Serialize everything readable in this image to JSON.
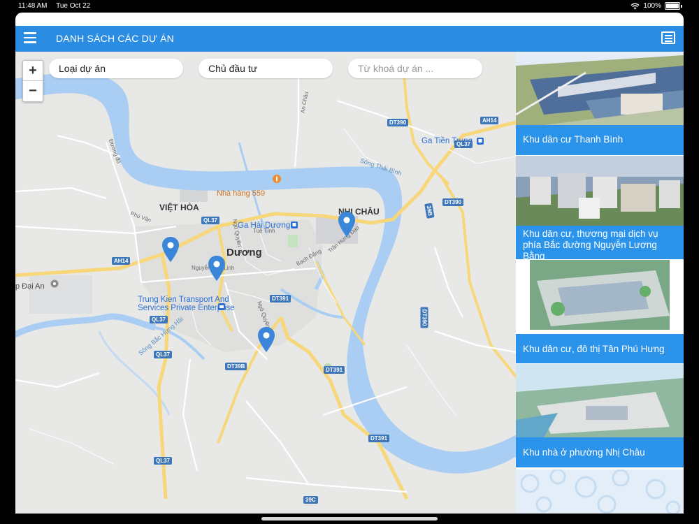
{
  "status_bar": {
    "time": "11:48 AM",
    "date": "Tue Oct 22",
    "battery": "100%",
    "icons": [
      "wifi-icon",
      "battery-icon"
    ]
  },
  "navbar": {
    "title": "DANH SÁCH CÁC DỰ ÁN",
    "menu_icon": "hamburger-menu-icon",
    "list_icon": "list-view-icon",
    "color": "#2a8de3"
  },
  "filters": {
    "project_type": "Loại dự án",
    "investor": "Chủ đầu tư",
    "keyword_placeholder": "Từ khoá dự án ..."
  },
  "zoom": {
    "in": "+",
    "out": "−"
  },
  "map": {
    "labels": {
      "viet_hoa": "VIỆT HÒA",
      "nhi_chau": "NHỊ CHÂU",
      "city": "Hải Dương",
      "city_partial": "Dương",
      "restaurant": "Nhà hàng 559",
      "station": "Ga Hải Dương",
      "station_tien_trung": "Ga Tiền Trung",
      "transport": "Trung Kien Transport\nAnd Services\nPrivate Enterprise",
      "river": "Sông Thái Bình",
      "river2": "Sông Bắc Hưng Hải",
      "dai_an": "p Đại An",
      "street": "Nguyễn Văn Linh",
      "street2": "Trần Hưng Đạo",
      "street3": "Tuệ Tĩnh",
      "street4": "Phú Vân",
      "street5": "Đường đỏ",
      "street6": "An Châu",
      "street7": "Ngô Quyền",
      "street8": "Bạch Đằng",
      "street9": "Ngô Quyền"
    },
    "road_shields": [
      "DT390",
      "AH14",
      "QL37",
      "DT390",
      "DT391",
      "DT39B",
      "DT391",
      "DT391",
      "QL37",
      "QL37",
      "AH14",
      "QL37",
      "QL37",
      "DT390",
      "39B",
      "39C"
    ],
    "pin_color": "#3b86d9",
    "pins": 4
  },
  "projects": [
    {
      "name": "Khu dân cư Thanh Bình"
    },
    {
      "name": "Khu dân cư, thương mại dịch vụ phía Bắc đường Nguyễn Lương Bằng"
    },
    {
      "name": "Khu dân cư, đô thị Tân Phú Hưng"
    },
    {
      "name": "Khu nhà ở phường Nhị Châu"
    }
  ],
  "accent": "#2b93ea"
}
